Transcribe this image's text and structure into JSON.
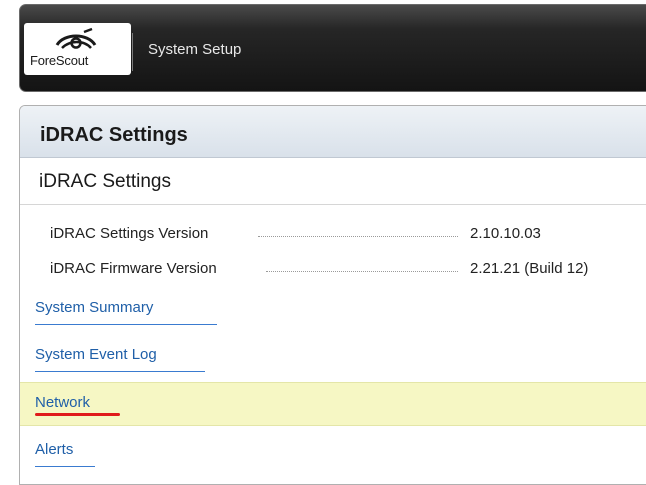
{
  "header": {
    "logo_text": "ForeScout",
    "title": "System Setup"
  },
  "panel": {
    "title": "iDRAC Settings",
    "heading": "iDRAC Settings"
  },
  "info": [
    {
      "label": "iDRAC Settings Version",
      "value": "2.10.10.03"
    },
    {
      "label": "iDRAC Firmware Version",
      "value": "2.21.21 (Build 12)"
    }
  ],
  "links": [
    {
      "label": "System Summary",
      "selected": false
    },
    {
      "label": "System Event Log",
      "selected": false
    },
    {
      "label": "Network",
      "selected": true
    },
    {
      "label": "Alerts",
      "selected": false
    }
  ],
  "colors": {
    "selected_row": "#f6f7c4",
    "link": "#1f5fa8",
    "annotation_underline": "#e01b1b"
  }
}
